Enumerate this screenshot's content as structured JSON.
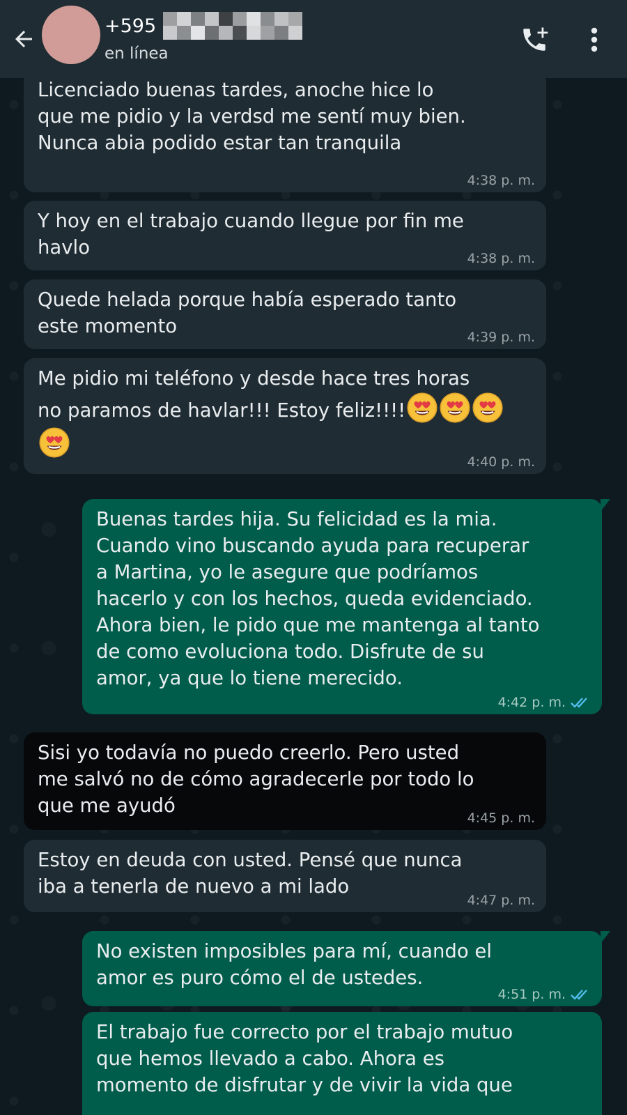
{
  "colors": {
    "header_bg": "#1f2c33",
    "chat_bg": "#0b141a",
    "incoming_bubble": "#202c33",
    "outgoing_bubble": "#005c4b",
    "read_ticks": "#53bdeb"
  },
  "header": {
    "back_icon": "arrow-left-icon",
    "contact_number": "+595",
    "contact_number_redacted": true,
    "status": "en línea",
    "call_icon": "add-call-icon",
    "menu_icon": "more-vertical-icon"
  },
  "messages": [
    {
      "direction": "incoming",
      "text": "Licenciado buenas tardes, anoche hice lo\nque me pidio y la verdsd me sentí muy bien.\nNunca abia podido estar tan tranquila",
      "time": "4:38 p. m."
    },
    {
      "direction": "incoming",
      "text": "Y hoy en el trabajo cuando llegue por fin me\nhavlo",
      "time": "4:38 p. m."
    },
    {
      "direction": "incoming",
      "text": "Quede helada porque había esperado tanto\neste momento",
      "time": "4:39 p. m."
    },
    {
      "direction": "incoming",
      "text": "Me pidio mi teléfono y desde hace tres horas\nno paramos de havlar!!! Estoy feliz!!!!",
      "emoji": "heart-eyes-emoji x4",
      "time": "4:40 p. m."
    },
    {
      "direction": "outgoing",
      "text": "Buenas tardes hija. Su felicidad es la mia.\nCuando vino buscando ayuda para recuperar\na Martina, yo le asegure que podríamos\nhacerlo y con los hechos, queda evidenciado.\nAhora bien, le pido que me mantenga al tanto\nde como evoluciona todo. Disfrute de su\namor, ya que lo tiene merecido.",
      "time": "4:42 p. m.",
      "status": "read"
    },
    {
      "direction": "incoming",
      "text": "Sisi yo todavía no puedo creerlo. Pero usted\nme salvó no de cómo agradecerle por todo lo\nque me ayudó",
      "time": "4:45 p. m."
    },
    {
      "direction": "incoming",
      "text": "Estoy en deuda con usted. Pensé que nunca\niba a tenerla de nuevo a mi lado",
      "time": "4:47 p. m."
    },
    {
      "direction": "outgoing",
      "text": "No existen imposibles para mí, cuando el\namor es puro cómo el de ustedes.",
      "time": "4:51 p. m.",
      "status": "read"
    },
    {
      "direction": "outgoing",
      "text": "El trabajo fue correcto por el trabajo mutuo\nque hemos llevado a cabo. Ahora es\nmomento de disfrutar y de vivir la vida que",
      "time": ""
    }
  ]
}
